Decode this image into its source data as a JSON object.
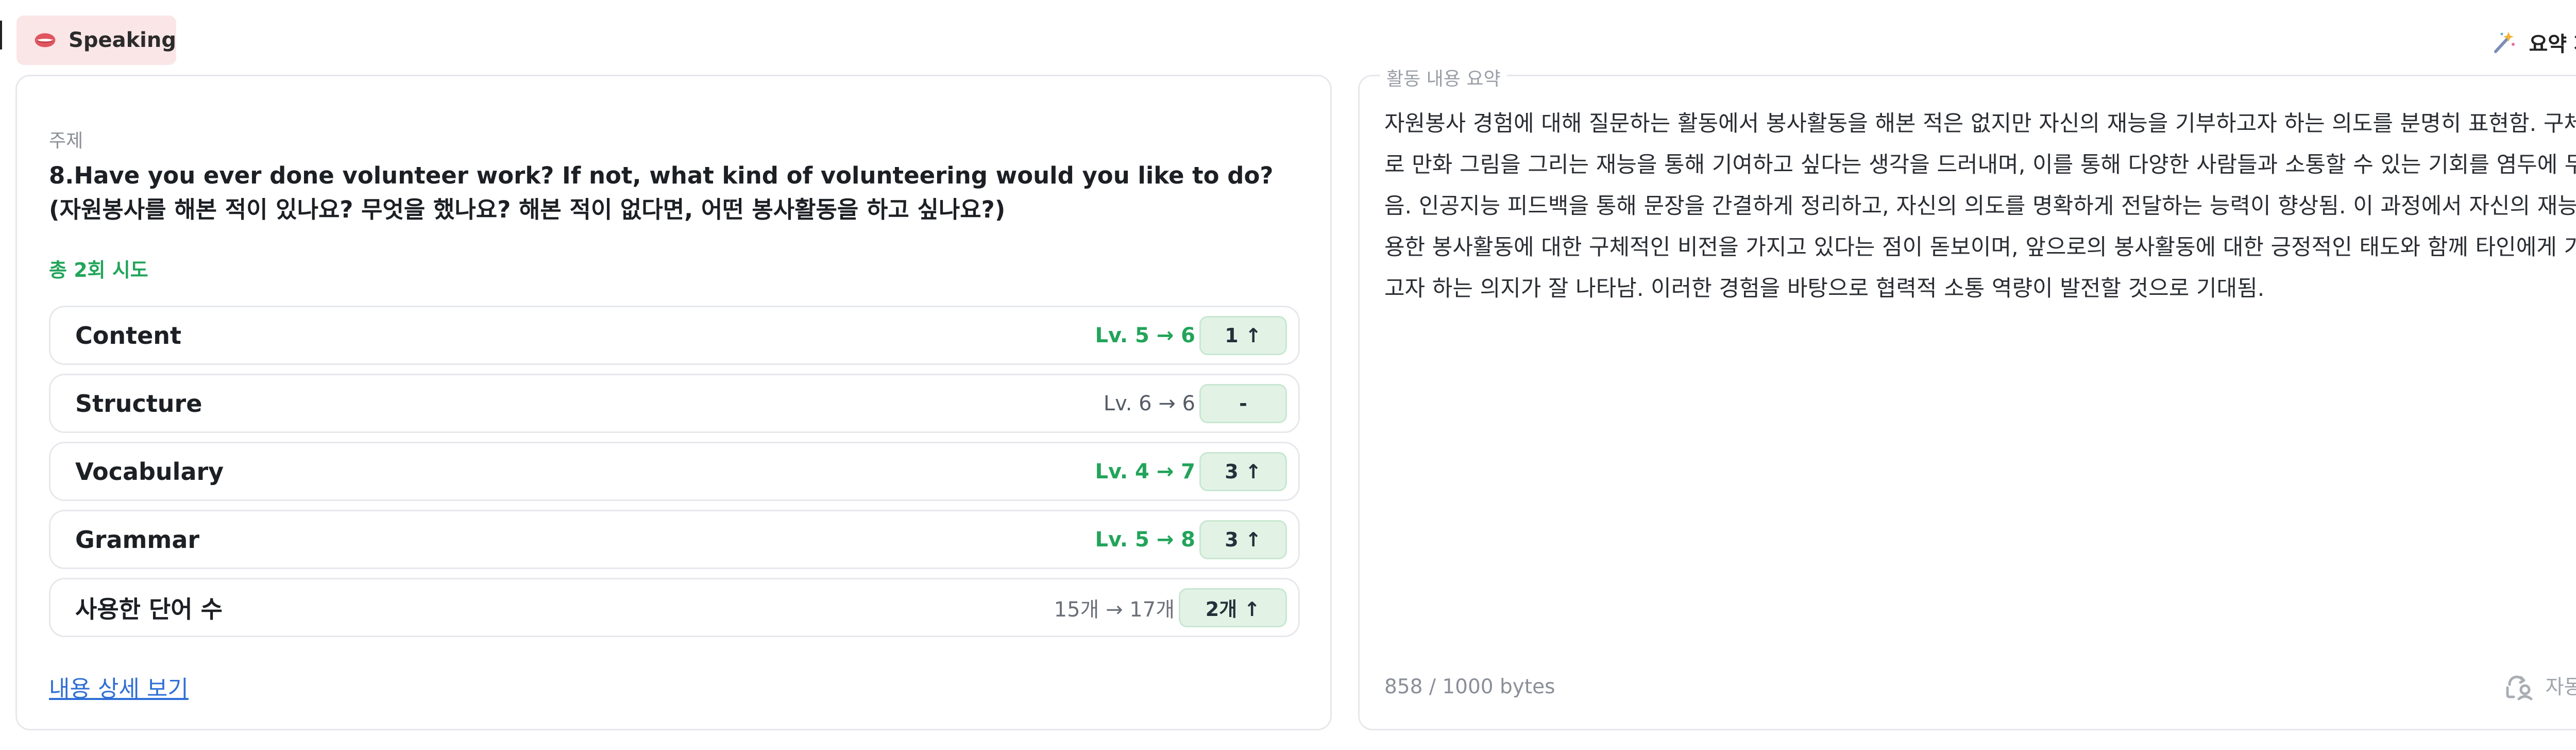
{
  "header": {
    "tag_label": "Speaking",
    "tag_icon": "lips-icon",
    "regenerate_label": "요약 재생성하기",
    "regenerate_icon": "magic-wand-icon"
  },
  "topic": {
    "label": "주제",
    "text": "8.Have you ever done volunteer work? If not, what kind of volunteering would you like to do? (자원봉사를 해본 적이 있나요? 무엇을 했나요? 해본 적이 없다면, 어떤 봉사활동을 하고 싶나요?)"
  },
  "attempts_label": "총 2회 시도",
  "metrics": [
    {
      "name": "Content",
      "change": "Lv. 5 → 6",
      "delta": "1 ↑"
    },
    {
      "name": "Structure",
      "change": "Lv. 6 → 6",
      "delta": "-"
    },
    {
      "name": "Vocabulary",
      "change": "Lv. 4 → 7",
      "delta": "3 ↑"
    },
    {
      "name": "Grammar",
      "change": "Lv. 5 → 8",
      "delta": "3 ↑"
    },
    {
      "name": "사용한 단어 수",
      "change": "15개 → 17개",
      "delta": "2개 ↑"
    }
  ],
  "detail_link": "내용 상세 보기",
  "summary": {
    "label": "활동 내용 요약",
    "text": "자원봉사 경험에 대해 질문하는 활동에서 봉사활동을 해본 적은 없지만 자신의 재능을 기부하고자 하는 의도를 분명히 표현함. 구체적으로 만화 그림을 그리는 재능을 통해 기여하고 싶다는 생각을 드러내며, 이를 통해 다양한 사람들과 소통할 수 있는 기회를 염두에 두고 있음. 인공지능 피드백을 통해 문장을 간결하게 정리하고, 자신의 의도를 명확하게 전달하는 능력이 향상됨. 이 과정에서 자신의 재능을 활용한 봉사활동에 대한 구체적인 비전을 가지고 있다는 점이 돋보이며, 앞으로의 봉사활동에 대한 긍정적인 태도와 함께 타인에게 기여하고자 하는 의지가 잘 나타남. 이러한 경험을 바탕으로 협력적 소통 역량이 발전할 것으로 기대됨.",
    "byte_count": "858 / 1000 bytes",
    "autosave_label": "자동 저장 중",
    "autosave_icon": "cloud-sync-icon"
  },
  "colors": {
    "accent_green": "#22a45a",
    "link_blue": "#2f6fd6",
    "tag_background": "#fbe6e7",
    "delta_background": "#e2f3e6"
  }
}
